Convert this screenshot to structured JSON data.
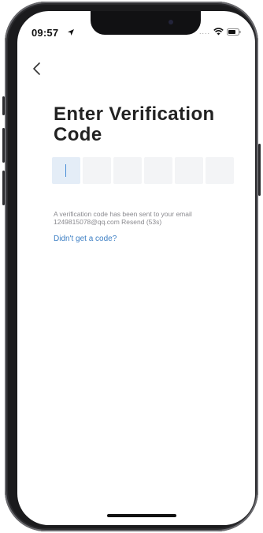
{
  "status_bar": {
    "time": "09:57",
    "signal": "....",
    "icons": [
      "location-arrow-icon",
      "wifi-icon",
      "battery-icon"
    ]
  },
  "nav": {
    "back_icon": "chevron-left-icon"
  },
  "page": {
    "title": "Enter Verification Code",
    "code_digits": [
      "",
      "",
      "",
      "",
      "",
      ""
    ],
    "info_text": "A verification code has been sent to your email",
    "email": "1249815078@qq.com",
    "resend_label": "Resend (53s)",
    "help_link": "Didn't get a code?"
  },
  "colors": {
    "accent": "#3d7fc4",
    "active_box": "#e4edf7",
    "inactive_box": "#f3f4f6",
    "caret": "#4a8fd8",
    "secondary_text": "#8a8a8f"
  }
}
